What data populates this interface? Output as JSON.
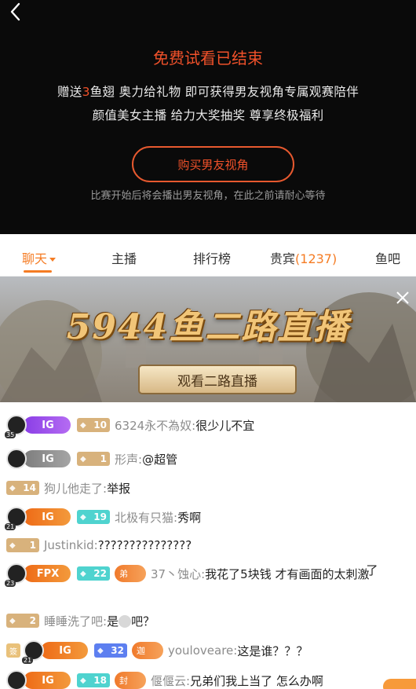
{
  "paywall": {
    "title": "免费试看已结束",
    "line1_prefix": "赠送",
    "line1_number": "3",
    "line1_suffix": "鱼翅 奥力给礼物 即可获得男友视角专属观赛陪伴",
    "line2": "颜值美女主播 给力大奖抽奖 尊享终极福利",
    "buy_button": "购买男友视角",
    "note": "比赛开始后将会播出男友视角，在此之前请耐心等待"
  },
  "tabs": {
    "chat": "聊天",
    "streamer": "主播",
    "ranking": "排行榜",
    "vip": "贵宾",
    "vip_count": "(1237)",
    "fishbar": "鱼吧"
  },
  "banner": {
    "title": "5944鱼二路直播",
    "button": "观看二路直播"
  },
  "chat": [
    {
      "avatar_level": "35",
      "team": "IG",
      "level": "10",
      "user": "6324永不為奴:",
      "text": "很少儿不宜"
    },
    {
      "avatar_level": "",
      "team": "IG",
      "level": "1",
      "user": "形声:",
      "text": "@超管"
    },
    {
      "level": "14",
      "user": "狗儿他走了:",
      "text": "举报"
    },
    {
      "avatar_level": "21",
      "team": "IG",
      "level": "19",
      "user": "北极有只猫:",
      "text": "秀啊"
    },
    {
      "level": "1",
      "user": "Justinkid:",
      "text": "???????????????"
    },
    {
      "avatar_level": "23",
      "team": "FPX",
      "level": "22",
      "fans": "弟",
      "user": "37丶蚀心:",
      "text": "我花了5块钱 才有画面的太刺激",
      "text2": "了"
    },
    {
      "level": "2",
      "user": "睡睡洗了吧:",
      "text_a": "是",
      "text_b": "吧？"
    },
    {
      "badge": "簽",
      "avatar_level": "21",
      "team": "IG",
      "level": "32",
      "fans": "迦",
      "user": "youloveare:",
      "text": "这是谁？？？"
    },
    {
      "avatar_level": "",
      "team": "IG",
      "level": "18",
      "fans": "封",
      "user": "偃偃云:",
      "text": "兄弟们我上当了 怎么办啊"
    }
  ],
  "colors": {
    "accent": "#f57c24",
    "paywall_red": "#f0512a",
    "team_purple": "#8a3ee6",
    "team_orange": "#ee6a16",
    "level_tan": "#d8b27c",
    "level_teal": "#4fd3cf",
    "level_blue": "#5d7ff0"
  },
  "icons": [
    "back-arrow-icon",
    "close-icon",
    "caret-down-icon",
    "fish-icon",
    "ig-logo-icon"
  ]
}
